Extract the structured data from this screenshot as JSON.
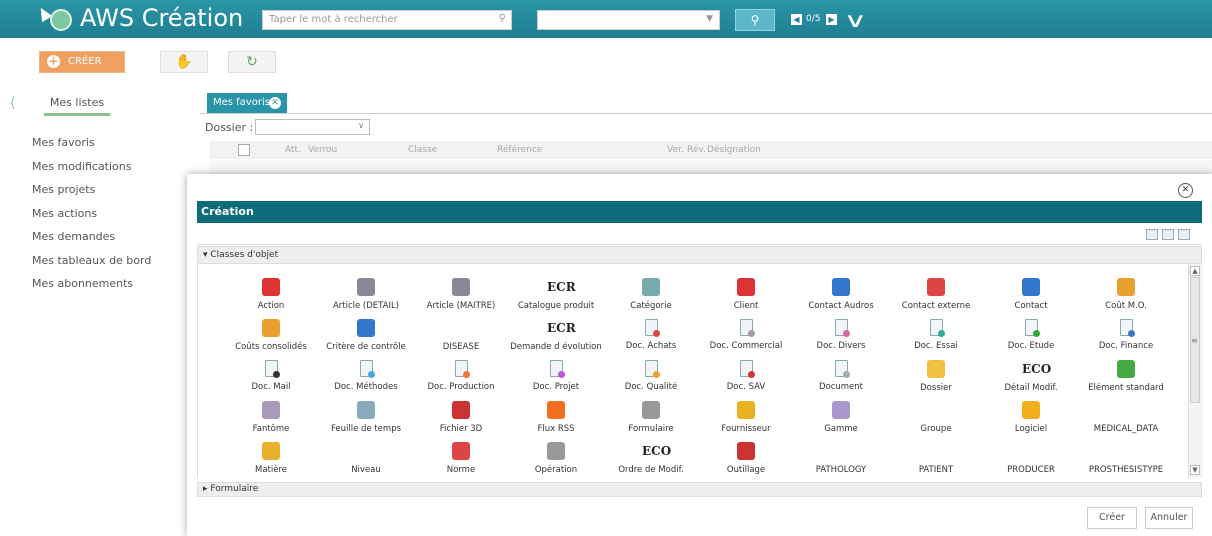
{
  "header": {
    "app_title": "AWS Création",
    "search_placeholder": "Taper le mot à rechercher",
    "nav_count": "0/5",
    "accent_color": "#1f7f91"
  },
  "toolbar": {
    "create_label": "CRÉER"
  },
  "sidebar": {
    "tab_label": "Mes listes",
    "items": [
      "Mes favoris",
      "Mes modifications",
      "Mes projets",
      "Mes actions",
      "Mes demandes",
      "Mes tableaux de bord",
      "Mes abonnements"
    ]
  },
  "favorites": {
    "tab_label": "Mes favoris",
    "dossier_label": "Dossier :",
    "columns": [
      "Att.",
      "Verrou",
      "Classe",
      "Référence",
      "Ver.",
      "Rév.",
      "Désignation"
    ]
  },
  "modal": {
    "title": "Création",
    "section_classes": "Classes d'objet",
    "section_formulaire": "Formulaire",
    "create_button": "Créer",
    "cancel_button": "Annuler",
    "items": [
      {
        "label": "Action",
        "icon": "clock-icon",
        "color": "#d33"
      },
      {
        "label": "Article (DETAIL)",
        "icon": "article-detail-icon",
        "color": "#889"
      },
      {
        "label": "Article (MAITRE)",
        "icon": "article-master-icon",
        "color": "#889"
      },
      {
        "label": "Catalogue produit",
        "icon": "ecr-icon",
        "color": "#222"
      },
      {
        "label": "Catégorie",
        "icon": "list-icon",
        "color": "#7aa"
      },
      {
        "label": "Client",
        "icon": "person-red-icon",
        "color": "#d33"
      },
      {
        "label": "Contact Audros",
        "icon": "contact-card-icon",
        "color": "#37c"
      },
      {
        "label": "Contact externe",
        "icon": "contact-card-red-icon",
        "color": "#d44"
      },
      {
        "label": "Contact",
        "icon": "contact-card-icon",
        "color": "#37c"
      },
      {
        "label": "Coût M.O.",
        "icon": "people-icon",
        "color": "#e9a030"
      },
      {
        "label": "Coûts consolidés",
        "icon": "sum-icon",
        "color": "#e9a030"
      },
      {
        "label": "Critère de contrôle",
        "icon": "eye-icon",
        "color": "#37c"
      },
      {
        "label": "DISEASE",
        "icon": "blank-icon",
        "color": "#fff"
      },
      {
        "label": "Demande d évolution",
        "icon": "ecr-icon",
        "color": "#222"
      },
      {
        "label": "Doc. Achats",
        "icon": "doc-icon",
        "color": "#d44"
      },
      {
        "label": "Doc. Commercial",
        "icon": "doc-icon",
        "color": "#a9a"
      },
      {
        "label": "Doc. Divers",
        "icon": "doc-icon",
        "color": "#d6a"
      },
      {
        "label": "Doc. Essai",
        "icon": "doc-icon",
        "color": "#3a9"
      },
      {
        "label": "Doc. Etude",
        "icon": "doc-icon",
        "color": "#3a3"
      },
      {
        "label": "Doc. Finance",
        "icon": "doc-icon",
        "color": "#37c"
      },
      {
        "label": "Doc. Mail",
        "icon": "doc-icon",
        "color": "#333"
      },
      {
        "label": "Doc. Méthodes",
        "icon": "doc-icon",
        "color": "#4ad"
      },
      {
        "label": "Doc. Production",
        "icon": "doc-icon",
        "color": "#e73"
      },
      {
        "label": "Doc. Projet",
        "icon": "doc-icon",
        "color": "#b5d"
      },
      {
        "label": "Doc. Qualité",
        "icon": "doc-icon",
        "color": "#e9a030"
      },
      {
        "label": "Doc. SAV",
        "icon": "doc-icon",
        "color": "#d33"
      },
      {
        "label": "Document",
        "icon": "doc-icon",
        "color": "#aaa"
      },
      {
        "label": "Dossier",
        "icon": "folder-icon",
        "color": "#f0c040"
      },
      {
        "label": "Détail Modif.",
        "icon": "eco-search-icon",
        "color": "#222"
      },
      {
        "label": "Elément standard",
        "icon": "books-icon",
        "color": "#4a4"
      },
      {
        "label": "Fantôme",
        "icon": "ghost-icon",
        "color": "#a9b"
      },
      {
        "label": "Feuille de temps",
        "icon": "timesheet-icon",
        "color": "#8ab"
      },
      {
        "label": "Fichier 3D",
        "icon": "shapes-3d-icon",
        "color": "#c33"
      },
      {
        "label": "Flux RSS",
        "icon": "rss-icon",
        "color": "#f07020"
      },
      {
        "label": "Formulaire",
        "icon": "form-icon",
        "color": "#999"
      },
      {
        "label": "Fournisseur",
        "icon": "person-yellow-icon",
        "color": "#e9b020"
      },
      {
        "label": "Gamme",
        "icon": "chart-icon",
        "color": "#a9c"
      },
      {
        "label": "Groupe",
        "icon": "blank-icon",
        "color": "#fff"
      },
      {
        "label": "Logiciel",
        "icon": "disc-icon",
        "color": "#f0b020"
      },
      {
        "label": "MEDICAL_DATA",
        "icon": "blank-icon",
        "color": "#fff"
      },
      {
        "label": "Matière",
        "icon": "material-icon",
        "color": "#e9b030"
      },
      {
        "label": "Niveau",
        "icon": "blank-icon",
        "color": "#fff"
      },
      {
        "label": "Norme",
        "icon": "norm-icon",
        "color": "#d44"
      },
      {
        "label": "Opération",
        "icon": "wrench-icon",
        "color": "#999"
      },
      {
        "label": "Ordre de Modif.",
        "icon": "eco-icon",
        "color": "#222"
      },
      {
        "label": "Outillage",
        "icon": "brush-icon",
        "color": "#c33"
      },
      {
        "label": "PATHOLOGY",
        "icon": "blank-icon",
        "color": "#fff"
      },
      {
        "label": "PATIENT",
        "icon": "blank-icon",
        "color": "#fff"
      },
      {
        "label": "PRODUCER",
        "icon": "blank-icon",
        "color": "#fff"
      },
      {
        "label": "PROSTHESISTYPE",
        "icon": "blank-icon",
        "color": "#fff"
      }
    ]
  }
}
